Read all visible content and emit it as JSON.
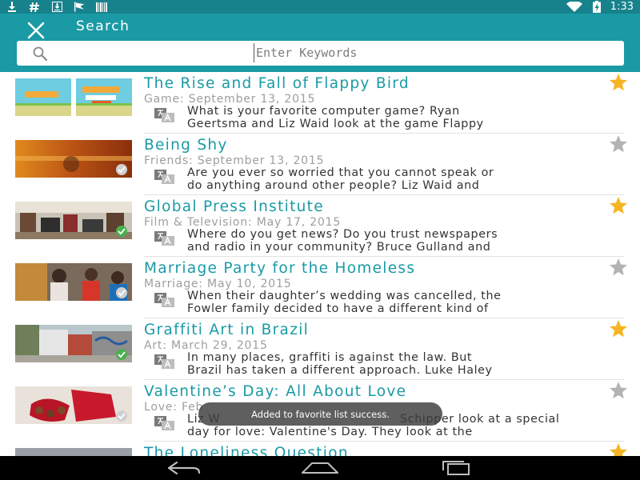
{
  "status_bar": {
    "time": "1:33",
    "left_icons": [
      "download-icon",
      "hash-icon",
      "download-box-icon",
      "flag-icon",
      "barcode-icon"
    ],
    "right_icons": [
      "wifi-icon",
      "battery-charging-icon"
    ]
  },
  "header": {
    "title": "Search",
    "close_icon": "close-icon"
  },
  "search": {
    "placeholder": "Enter Keywords",
    "value": ""
  },
  "colors": {
    "primary": "#1a9aa5",
    "status_bar": "#17828c",
    "star_active": "#f5b523",
    "star_inactive": "#b3b3b3",
    "title": "#1a9aa5"
  },
  "items": [
    {
      "title": "The Rise and Fall of Flappy Bird",
      "meta": "Game: September 13, 2015",
      "desc1": "What is your favorite computer game? Ryan",
      "desc2": "Geertsma and Liz Waid look at the game Flappy",
      "favorite": true,
      "checked": false
    },
    {
      "title": "Being Shy",
      "meta": "Friends: September 13, 2015",
      "desc1": "Are you ever so worried that you cannot speak or",
      "desc2": "do anything around other people? Liz Waid and",
      "favorite": false,
      "checked": true
    },
    {
      "title": "Global Press Institute",
      "meta": "Film & Television: May 17, 2015",
      "desc1": "Where do you get news? Do you trust newspapers",
      "desc2": "and radio in your community? Bruce Gulland and",
      "favorite": true,
      "checked": true
    },
    {
      "title": "Marriage Party for the Homeless",
      "meta": "Marriage: May 10, 2015",
      "desc1": "When their daughter’s wedding was cancelled, the",
      "desc2": "Fowler family decided to have a different kind of",
      "favorite": false,
      "checked": true
    },
    {
      "title": "Graffiti Art in Brazil",
      "meta": "Art: March 29, 2015",
      "desc1": "In many places, graffiti is against the law. But",
      "desc2": "Brazil has taken a different approach. Luke Haley",
      "favorite": true,
      "checked": true
    },
    {
      "title": "Valentine’s Day: All About Love",
      "meta": "Love: Feb",
      "desc1": "Liz W",
      "desc2": "day for love: Valentine's Day. They look at the",
      "desc1_tail": "Schipper look at a special",
      "favorite": false,
      "checked": true
    },
    {
      "title": "The Loneliness Question",
      "meta": "",
      "desc1": "",
      "desc2": "",
      "favorite": true,
      "checked": false
    }
  ],
  "toast": {
    "message": "Added to favorite list success."
  },
  "nav_bar": {
    "buttons": [
      "back-icon",
      "home-icon",
      "recents-icon"
    ]
  }
}
